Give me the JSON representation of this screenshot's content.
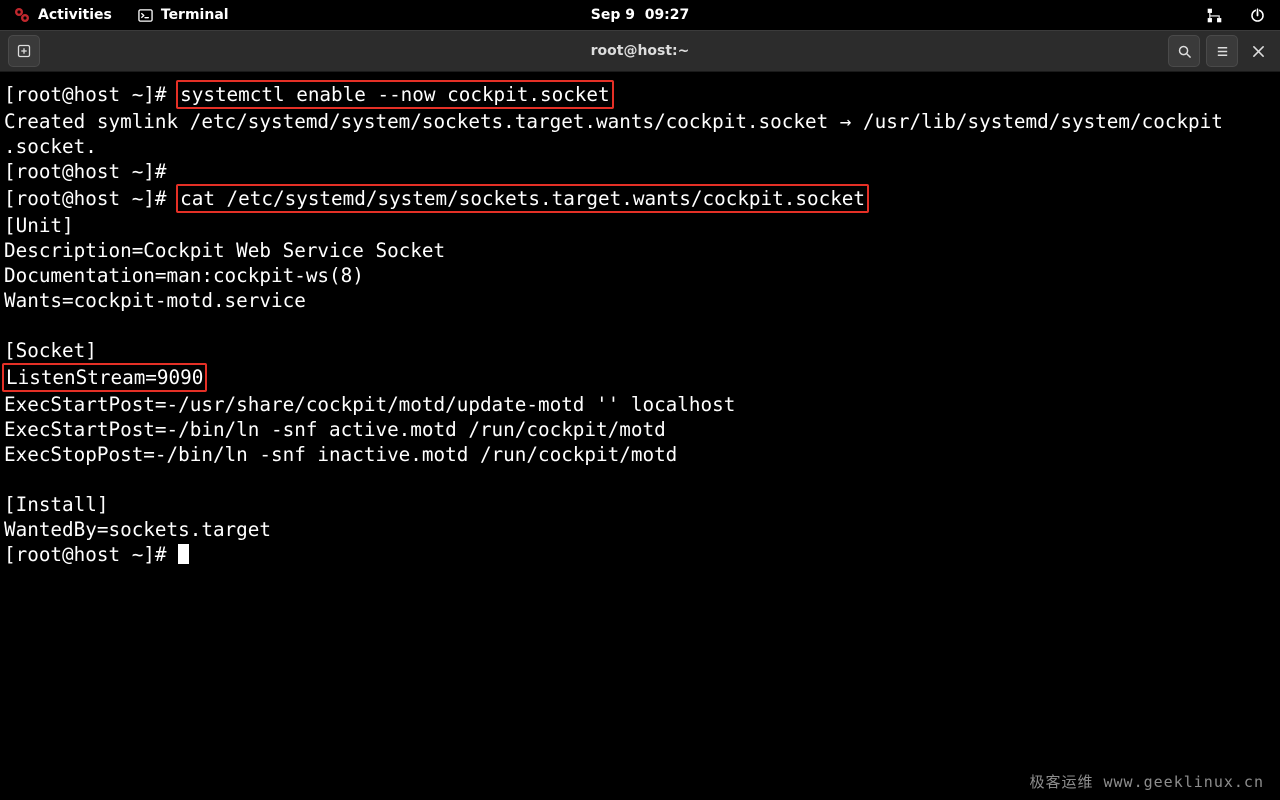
{
  "topbar": {
    "activities": "Activities",
    "terminal": "Terminal",
    "clock": "Sep 9  09:27"
  },
  "window": {
    "title": "root@host:~"
  },
  "term": {
    "prompt": "[root@host ~]# ",
    "cmd1": "systemctl enable --now cockpit.socket",
    "out1a": "Created symlink /etc/systemd/system/sockets.target.wants/cockpit.socket → /usr/lib/systemd/system/cockpit",
    "out1b": ".socket.",
    "cmd2": "cat /etc/systemd/system/sockets.target.wants/cockpit.socket",
    "unit_hdr": "[Unit]",
    "unit_desc": "Description=Cockpit Web Service Socket",
    "unit_doc": "Documentation=man:cockpit-ws(8)",
    "unit_wants": "Wants=cockpit-motd.service",
    "sock_hdr": "[Socket]",
    "sock_listen": "ListenStream=9090",
    "sock_esp1": "ExecStartPost=-/usr/share/cockpit/motd/update-motd '' localhost",
    "sock_esp2": "ExecStartPost=-/bin/ln -snf active.motd /run/cockpit/motd",
    "sock_estop": "ExecStopPost=-/bin/ln -snf inactive.motd /run/cockpit/motd",
    "inst_hdr": "[Install]",
    "inst_wb": "WantedBy=sockets.target"
  },
  "watermark": "极客运维 www.geeklinux.cn"
}
